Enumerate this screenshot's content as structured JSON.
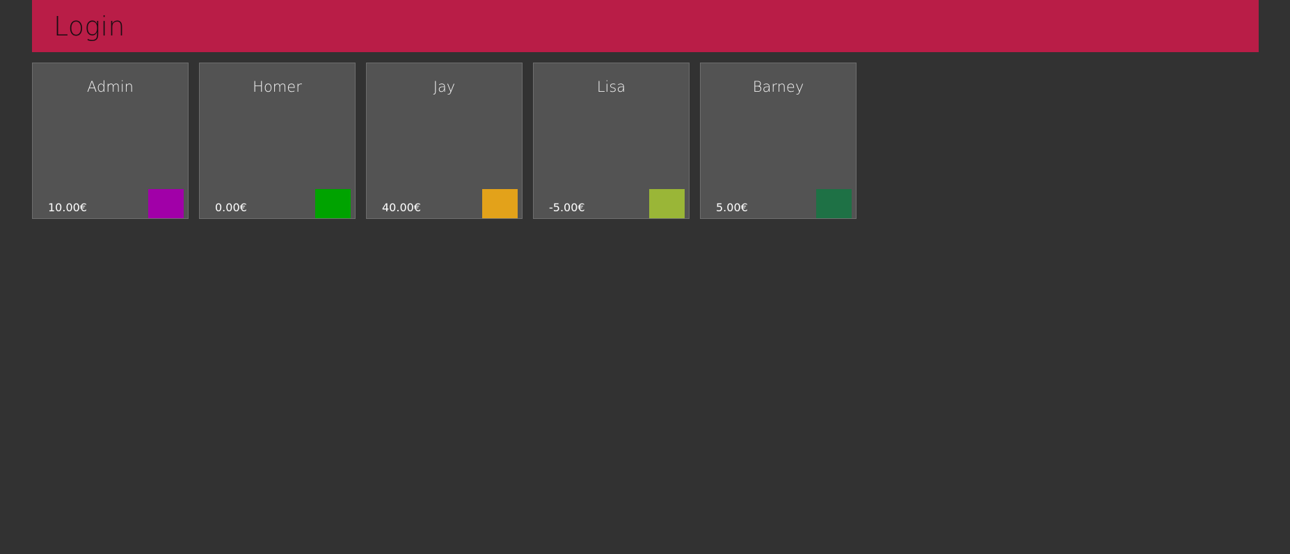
{
  "header": {
    "title": "Login",
    "background": "#b91d47"
  },
  "users": [
    {
      "name": "Admin",
      "balance": "10.00€",
      "color": "#a100a8"
    },
    {
      "name": "Homer",
      "balance": "0.00€",
      "color": "#00a300"
    },
    {
      "name": "Jay",
      "balance": "40.00€",
      "color": "#e3a21a"
    },
    {
      "name": "Lisa",
      "balance": "-5.00€",
      "color": "#9ab637"
    },
    {
      "name": "Barney",
      "balance": "5.00€",
      "color": "#1e7145"
    }
  ]
}
